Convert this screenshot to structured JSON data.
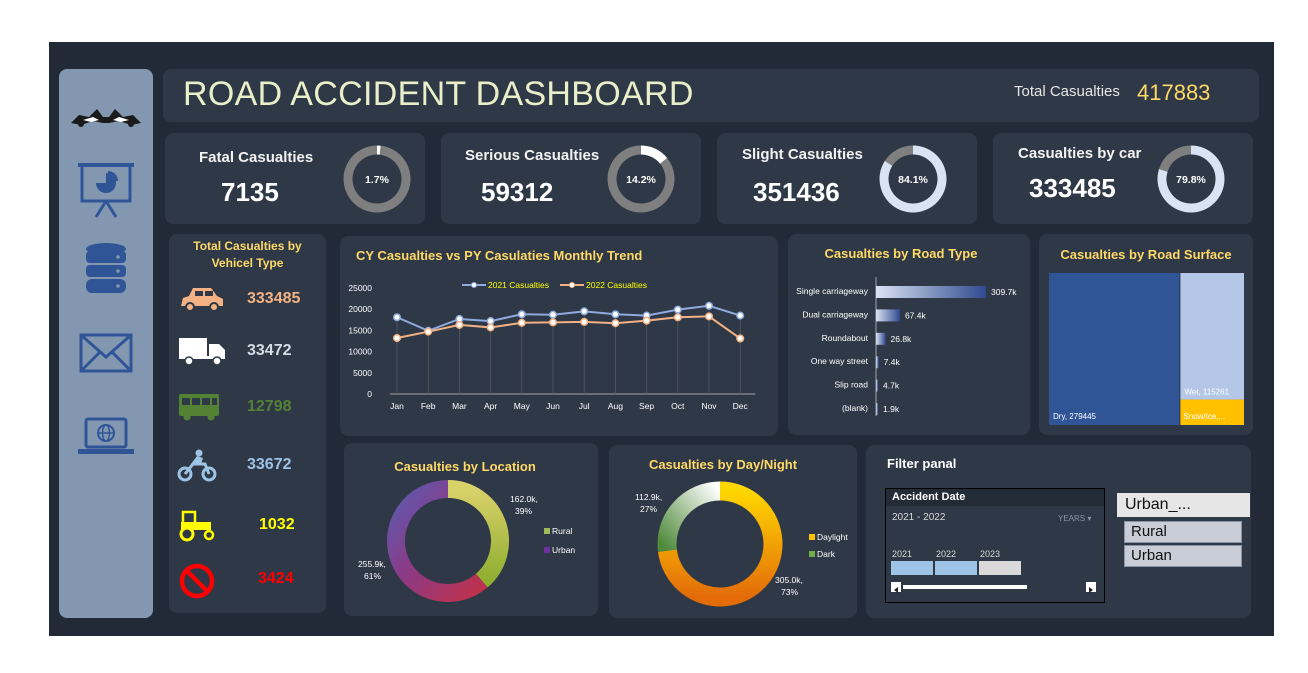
{
  "header": {
    "title": "ROAD ACCIDENT DASHBOARD",
    "total_label": "Total Casualties",
    "total_value": "417883"
  },
  "kpis": [
    {
      "label": "Fatal Casualties",
      "value": "7135",
      "pct_label": "1.7%",
      "pct": 1.7
    },
    {
      "label": "Serious Casualties",
      "value": "59312",
      "pct_label": "14.2%",
      "pct": 14.2
    },
    {
      "label": "Slight Casualties",
      "value": "351436",
      "pct_label": "84.1%",
      "pct": 84.1
    },
    {
      "label": "Casualties by car",
      "value": "333485",
      "pct_label": "79.8%",
      "pct": 79.8
    }
  ],
  "vehicle": {
    "title_line1": "Total Casualties by",
    "title_line2": "Vehicel Type",
    "items": [
      {
        "icon": "car-icon",
        "value": "333485",
        "color": "#f4b183"
      },
      {
        "icon": "truck-icon",
        "value": "33472",
        "color": "#d6dce5"
      },
      {
        "icon": "bus-icon",
        "value": "12798",
        "color": "#548235"
      },
      {
        "icon": "motorcycle-icon",
        "value": "33672",
        "color": "#9dc3e6"
      },
      {
        "icon": "tractor-icon",
        "value": "1032",
        "color": "#ffff00"
      },
      {
        "icon": "no-entry-icon",
        "value": "3424",
        "color": "#ff0000"
      }
    ]
  },
  "colors": {
    "accent": "#ffd966",
    "cy": "#8faadc",
    "py": "#f4b183",
    "frame": "#212a36",
    "card": "#2e3846"
  },
  "chart_data": [
    {
      "type": "line",
      "title": "CY Casualties vs PY Casulaties Monthly Trend",
      "categories": [
        "Jan",
        "Feb",
        "Mar",
        "Apr",
        "May",
        "Jun",
        "Jul",
        "Aug",
        "Sep",
        "Oct",
        "Nov",
        "Dec"
      ],
      "series": [
        {
          "name": "2021 Casualties",
          "values": [
            18100,
            14900,
            17700,
            17200,
            18800,
            18700,
            19500,
            18800,
            18500,
            19900,
            20800,
            18500
          ]
        },
        {
          "name": "2022 Casualties",
          "values": [
            13200,
            14700,
            16300,
            15700,
            16800,
            16900,
            17000,
            16700,
            17300,
            18100,
            18300,
            13100
          ]
        }
      ],
      "yticks": [
        "0",
        "5000",
        "10000",
        "15000",
        "20000",
        "25000"
      ],
      "ylim": [
        0,
        25000
      ],
      "grid": "vertical drop lines",
      "legend": "top"
    },
    {
      "type": "bar",
      "title": "Casualties by Road Type",
      "categories": [
        "Single carriageway",
        "Dual carriageway",
        "Roundabout",
        "One way street",
        "Slip road",
        "(blank)"
      ],
      "values": [
        309.7,
        67.4,
        26.8,
        7.4,
        4.7,
        1.9
      ],
      "value_labels": [
        "309.7k",
        "67.4k",
        "26.8k",
        "7.4k",
        "4.7k",
        "1.9k"
      ],
      "orientation": "horizontal"
    },
    {
      "type": "heatmap",
      "title": "Casualties by Road Surface",
      "categories": [
        "Dry",
        "Wet",
        "Snow/Ice"
      ],
      "values": [
        279445,
        115261,
        23177
      ],
      "labels": [
        "Dry, 279445",
        "Wet, 115261",
        "Snow/Ice,..."
      ]
    },
    {
      "type": "pie",
      "title": "Casualties by Location",
      "categories": [
        "Rural",
        "Urban"
      ],
      "values": [
        162.0,
        255.9
      ],
      "labels": [
        [
          "162.0k,",
          "39%"
        ],
        [
          "255.9k,",
          "61%"
        ]
      ]
    },
    {
      "type": "pie",
      "title": "Casualties by Day/Night",
      "categories": [
        "Daylight",
        "Dark"
      ],
      "values": [
        305.0,
        112.9
      ],
      "labels": [
        [
          "305.0k,",
          "73%"
        ],
        [
          "112.9k,",
          "27%"
        ]
      ]
    }
  ],
  "filter": {
    "title": "Filter panal",
    "timeline_header": "Accident Date",
    "range": "2021 - 2022",
    "unit": "YEARS",
    "years": [
      "2021",
      "2022",
      "2023"
    ],
    "year_selected": [
      true,
      true,
      false
    ],
    "slicer_header": "Urban_...",
    "slicer_items": [
      "Rural",
      "Urban"
    ]
  }
}
